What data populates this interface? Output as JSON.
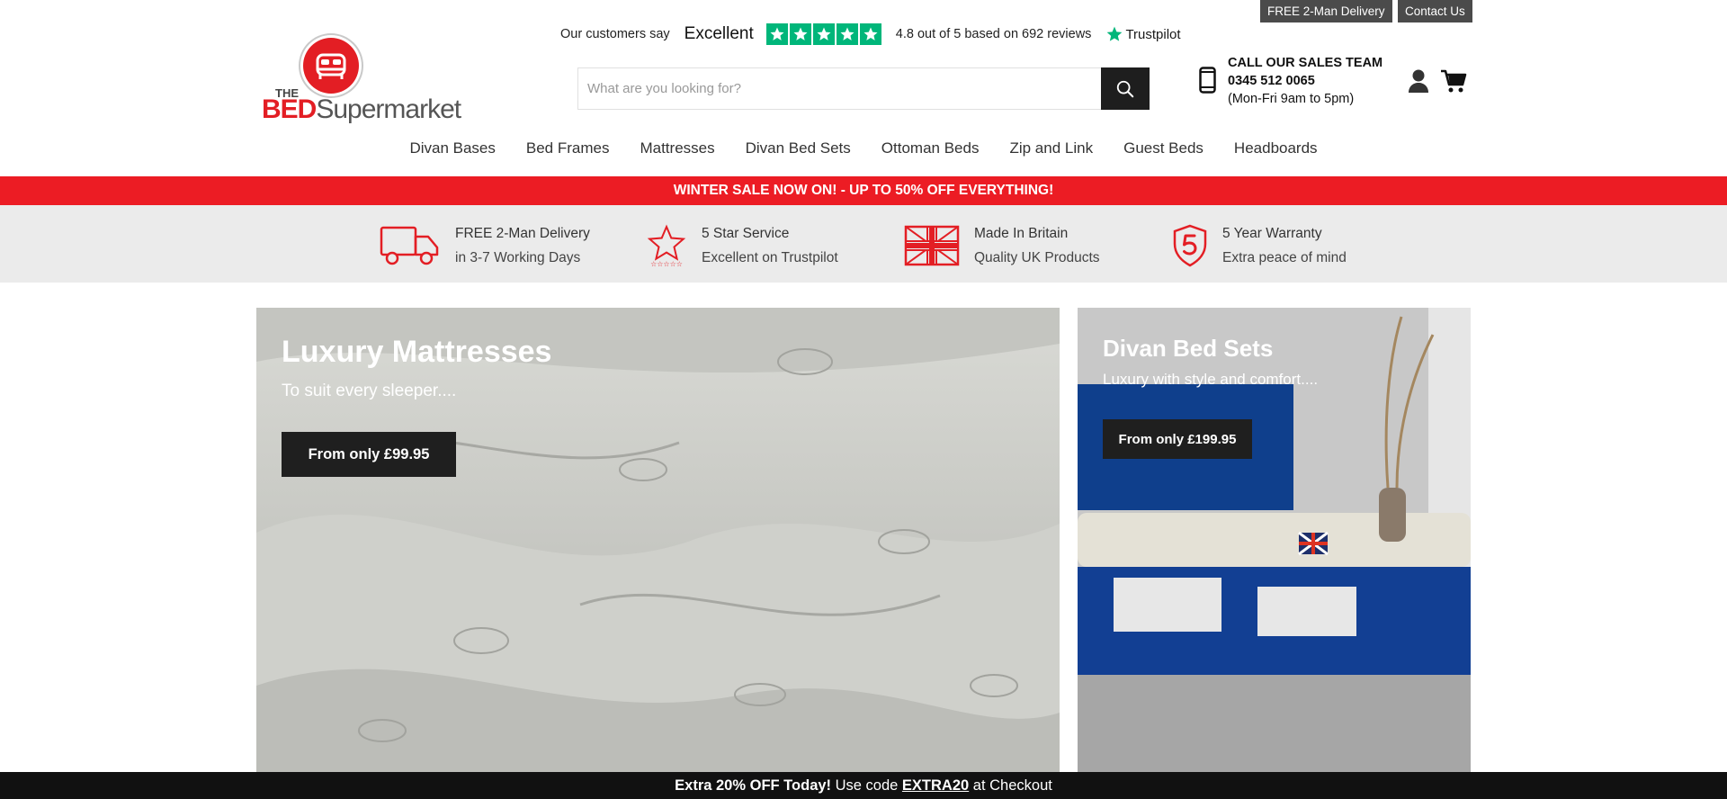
{
  "utility": {
    "delivery_label": "FREE 2-Man Delivery",
    "contact_label": "Contact Us"
  },
  "trustpilot": {
    "say": "Our customers say",
    "verdict": "Excellent",
    "stars": 5,
    "rating_text": "4.8 out of 5 based on 692 reviews",
    "brand": "Trustpilot",
    "star_color": "#00b67a"
  },
  "logo": {
    "the": "THE",
    "bed": "BED",
    "supermarket": "Supermarket"
  },
  "search": {
    "placeholder": "What are you looking for?",
    "value": ""
  },
  "sales": {
    "heading": "CALL OUR SALES TEAM",
    "phone": "0345 512 0065",
    "hours": "(Mon-Fri 9am to 5pm)"
  },
  "nav": [
    {
      "label": "Divan Bases"
    },
    {
      "label": "Bed Frames"
    },
    {
      "label": "Mattresses"
    },
    {
      "label": "Divan Bed Sets"
    },
    {
      "label": "Ottoman Beds"
    },
    {
      "label": "Zip and Link"
    },
    {
      "label": "Guest Beds"
    },
    {
      "label": "Headboards"
    }
  ],
  "sale_banner": "WINTER SALE NOW ON! - UP TO 50% OFF EVERYTHING!",
  "usps": [
    {
      "icon": "truck-icon",
      "title": "FREE 2-Man Delivery",
      "subtitle": "in 3-7 Working Days"
    },
    {
      "icon": "star-icon",
      "title": "5 Star Service",
      "subtitle": "Excellent on Trustpilot"
    },
    {
      "icon": "union-flag-icon",
      "title": "Made In Britain",
      "subtitle": "Quality UK Products"
    },
    {
      "icon": "warranty-shield-icon",
      "title": "5 Year Warranty",
      "subtitle": "Extra peace of mind"
    }
  ],
  "heroes": {
    "mattresses": {
      "title": "Luxury Mattresses",
      "subtitle": "To suit every sleeper....",
      "cta": "From only £99.95"
    },
    "divan_sets": {
      "title": "Divan Bed Sets",
      "subtitle": "Luxury with style and comfort....",
      "cta": "From only £199.95"
    }
  },
  "promo": {
    "lead": "Extra 20% OFF Today!",
    "mid": " Use code ",
    "code": "EXTRA20",
    "tail": " at Checkout"
  },
  "colors": {
    "brand_red": "#ec1c24",
    "dark": "#1e1e1e",
    "usp_bg": "#ebebeb"
  }
}
